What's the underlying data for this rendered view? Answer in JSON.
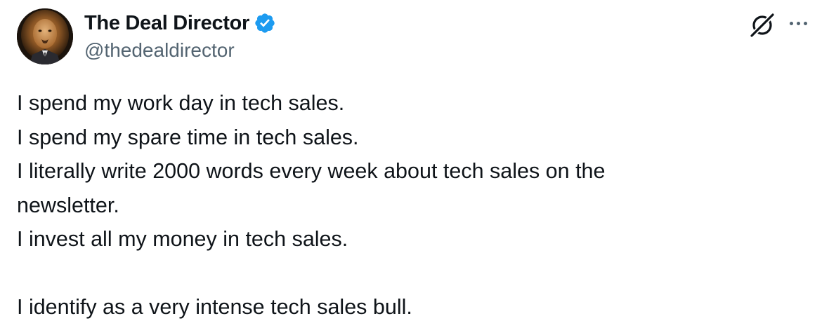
{
  "author": {
    "display_name": "The Deal Director",
    "handle": "@thedealdirector",
    "verified": true,
    "avatar_icon": "lion-avatar",
    "verified_color": "#1d9bf0"
  },
  "header_actions": {
    "grok_icon": "grok-icon",
    "more_icon": "more-icon"
  },
  "tweet": {
    "lines": [
      "I spend my work day in tech sales.",
      "I spend my spare time in tech sales.",
      "I literally write 2000 words every week about tech sales on the",
      "newsletter.",
      "I invest all my money in tech sales.",
      "",
      "I identify as a very intense tech sales bull."
    ]
  },
  "colors": {
    "text": "#0f1419",
    "secondary": "#536471",
    "accent": "#1d9bf0",
    "background": "#ffffff"
  }
}
